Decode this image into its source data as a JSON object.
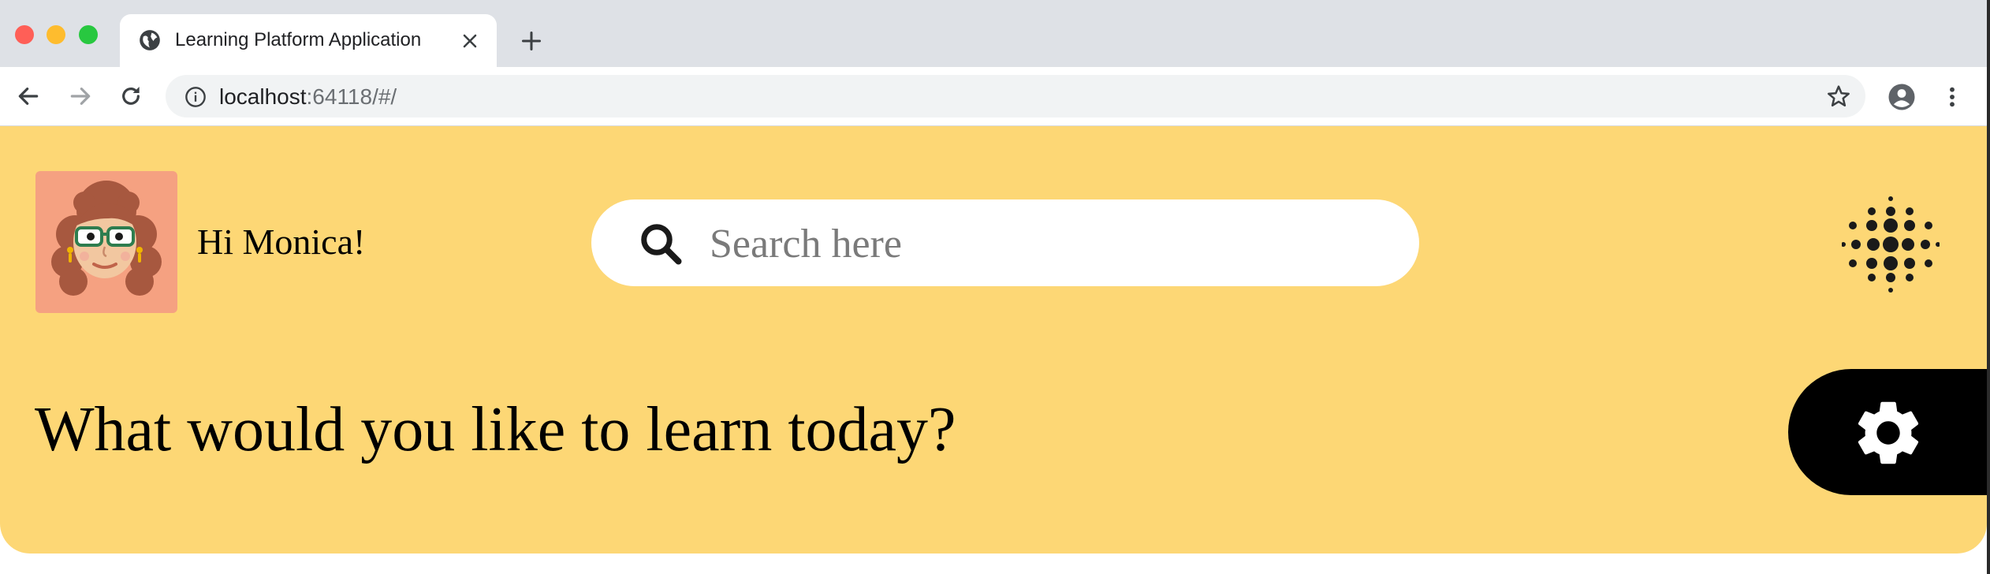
{
  "browser": {
    "tab_title": "Learning Platform Application",
    "url_host": "localhost",
    "url_rest": ":64118/#/"
  },
  "header": {
    "greeting": "Hi Monica!",
    "search_placeholder": "Search here",
    "headline": "What would you like to learn today?"
  },
  "colors": {
    "hero_background": "#fdd775",
    "avatar_background": "#f5a181",
    "settings_tab": "#000000"
  },
  "icons": [
    "globe-icon",
    "close-icon",
    "plus-icon",
    "back-icon",
    "forward-icon",
    "reload-icon",
    "info-icon",
    "star-icon",
    "account-icon",
    "menu-icon",
    "search-icon",
    "dots-logo-icon",
    "gear-icon"
  ]
}
